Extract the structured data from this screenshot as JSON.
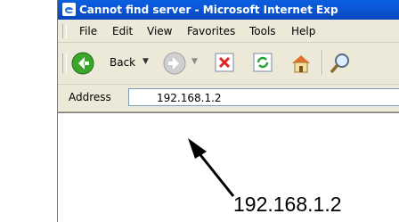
{
  "window": {
    "title": "Cannot find server - Microsoft Internet Exp"
  },
  "menu": {
    "items": [
      "File",
      "Edit",
      "View",
      "Favorites",
      "Tools",
      "Help"
    ]
  },
  "toolbar": {
    "back_label": "Back",
    "icons": [
      "back-icon",
      "forward-icon",
      "stop-icon",
      "refresh-icon",
      "home-icon",
      "search-icon"
    ]
  },
  "address": {
    "label": "Address",
    "value": "192.168.1.2"
  },
  "annotation": {
    "text": "192.168.1.2"
  }
}
